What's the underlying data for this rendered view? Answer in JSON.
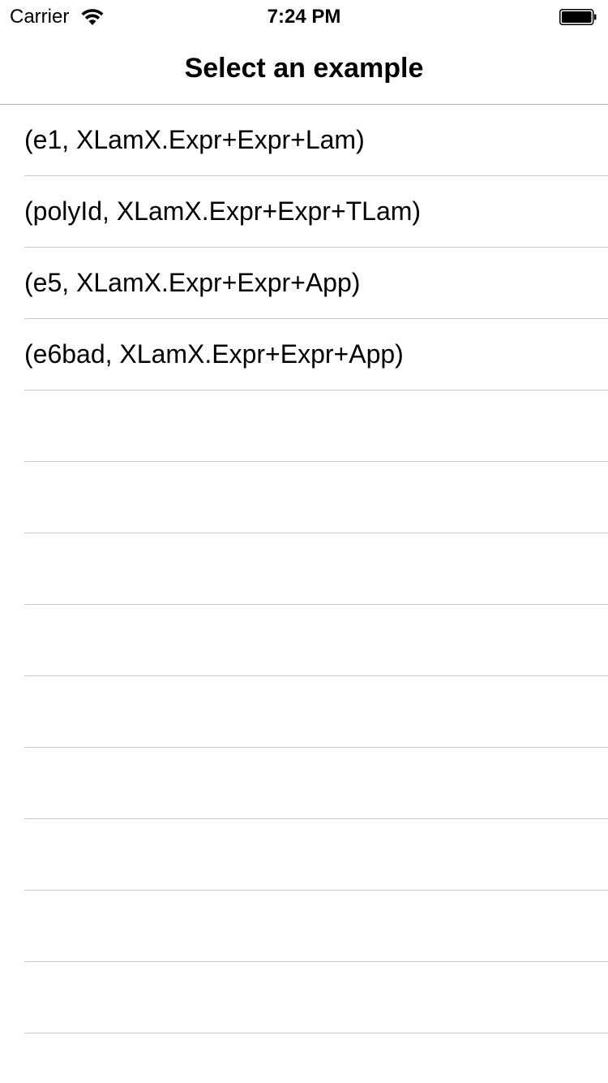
{
  "status_bar": {
    "carrier": "Carrier",
    "time": "7:24 PM",
    "wifi_icon": "wifi-icon",
    "battery_icon": "battery-icon"
  },
  "nav": {
    "title": "Select an example"
  },
  "list": {
    "items": [
      {
        "label": "(e1, XLamX.Expr+Expr+Lam)"
      },
      {
        "label": "(polyId, XLamX.Expr+Expr+TLam)"
      },
      {
        "label": "(e5, XLamX.Expr+Expr+App)"
      },
      {
        "label": "(e6bad, XLamX.Expr+Expr+App)"
      },
      {
        "label": ""
      },
      {
        "label": ""
      },
      {
        "label": ""
      },
      {
        "label": ""
      },
      {
        "label": ""
      },
      {
        "label": ""
      },
      {
        "label": ""
      },
      {
        "label": ""
      },
      {
        "label": ""
      },
      {
        "label": ""
      }
    ]
  }
}
